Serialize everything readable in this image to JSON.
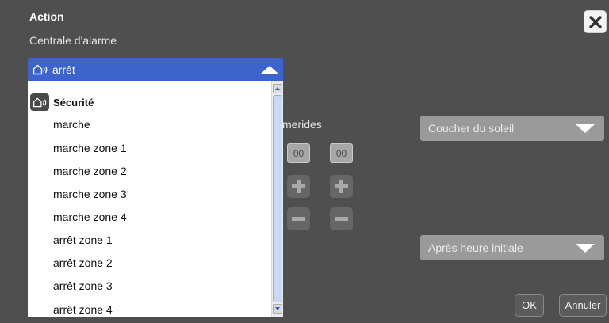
{
  "dialog": {
    "title": "Action",
    "subtitle": "Centrale d'alarme",
    "close_icon": "close-icon"
  },
  "dropdown": {
    "selected_label": "arrêt",
    "selected_icon": "alarm-home-icon",
    "group_label": "Sécurité",
    "group_icon": "alarm-home-icon",
    "options": [
      "marche",
      "marche zone 1",
      "marche zone 2",
      "marche zone 3",
      "marche zone 4",
      "arrêt zone 1",
      "arrêt zone 2",
      "arrêt zone 3",
      "arrêt zone 4"
    ]
  },
  "background": {
    "ephemerides_label": "merides",
    "sunset_select": "Coucher du soleil",
    "after_select": "Après heure initiale",
    "hours": "00",
    "minutes": "00"
  },
  "buttons": {
    "ok": "OK",
    "cancel": "Annuler"
  }
}
